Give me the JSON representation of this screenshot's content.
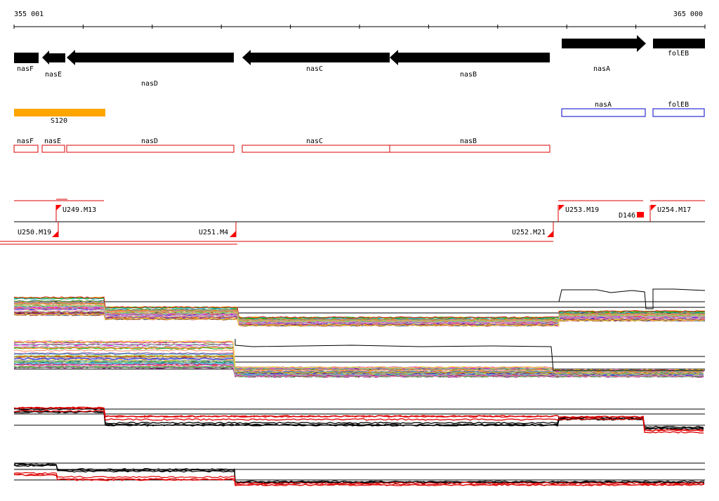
{
  "ruler": {
    "start_label": "355 001",
    "end_label": "365 000"
  },
  "genes": [
    {
      "name": "nasF",
      "strand": "-"
    },
    {
      "name": "nasE",
      "strand": "-"
    },
    {
      "name": "nasD",
      "strand": "-"
    },
    {
      "name": "nasC",
      "strand": "-"
    },
    {
      "name": "nasB",
      "strand": "-"
    },
    {
      "name": "nasA",
      "strand": "+"
    },
    {
      "name": "folEB",
      "strand": "+"
    }
  ],
  "regulatory_feature": {
    "label": "S120",
    "color": "#ffa500"
  },
  "forward_boxes": [
    {
      "label": "nasA"
    },
    {
      "label": "folEB"
    }
  ],
  "reverse_boxes": [
    {
      "label": "nasF"
    },
    {
      "label": "nasE"
    },
    {
      "label": "nasD"
    },
    {
      "label": "nasC"
    },
    {
      "label": "nasB"
    }
  ],
  "transcription_units": {
    "top": [
      "U249.M13",
      "U253.M19",
      "U254.M17"
    ],
    "bottom": [
      "U250.M19",
      "U251.M4",
      "U252.M21"
    ],
    "marker": "D146"
  },
  "colors": {
    "forward_box": "#0000cc",
    "reverse_box": "#dd0000",
    "marker": "#ff0000"
  }
}
